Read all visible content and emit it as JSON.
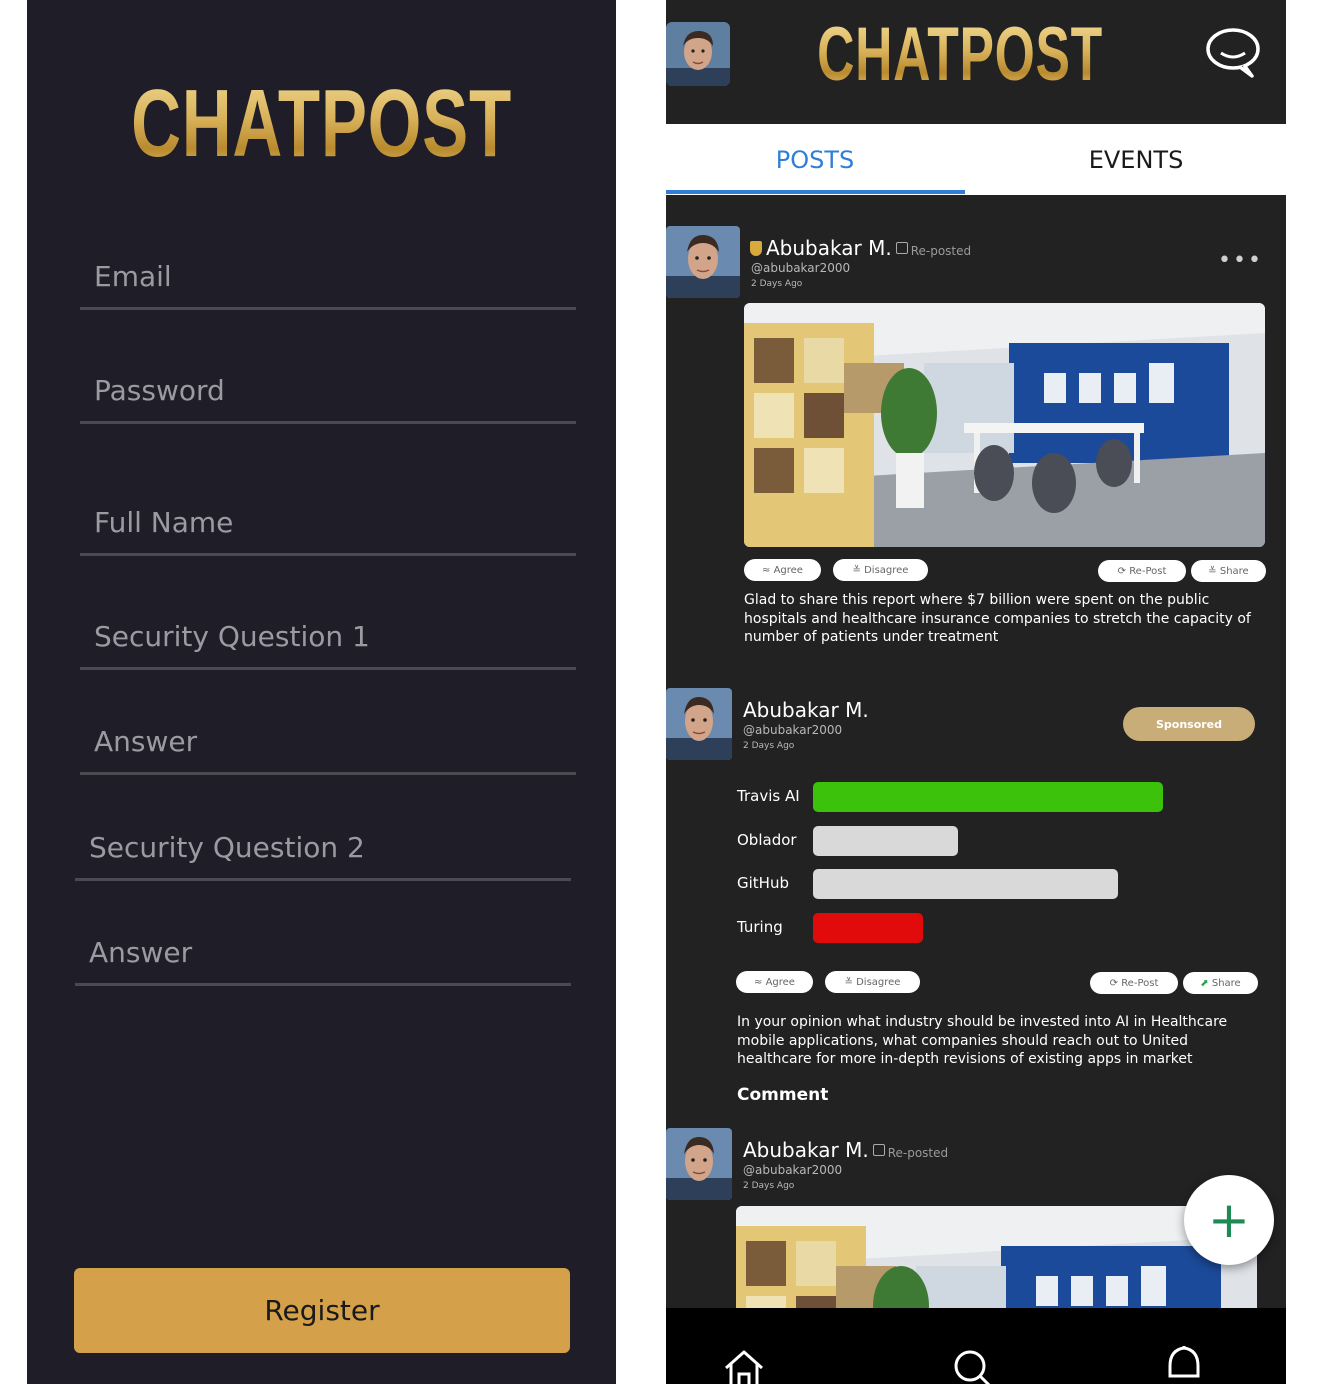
{
  "register": {
    "logo_text": "CHATPOST",
    "fields": [
      {
        "placeholder": "Email"
      },
      {
        "placeholder": "Password"
      },
      {
        "placeholder": "Full Name"
      },
      {
        "placeholder": "Security Question 1"
      },
      {
        "placeholder": "Answer"
      },
      {
        "placeholder": "Security Question 2"
      },
      {
        "placeholder": "Answer"
      }
    ],
    "register_button": "Register"
  },
  "feed": {
    "logo_text": "CHATPOST",
    "tabs": [
      {
        "label": "POSTS",
        "active": true
      },
      {
        "label": "EVENTS",
        "active": false
      }
    ],
    "posts": [
      {
        "author": "Abubakar M.",
        "badge": "Re-posted",
        "handle": "@abubakar2000",
        "time": "2 Days Ago",
        "actions": {
          "agree": "Agree",
          "disagree": "Disagree",
          "repost": "Re-Post",
          "share": "Share"
        },
        "text": "Glad to share this report where $7 billion were spent on the public hospitals and healthcare insurance companies to stretch the capacity of number of patients under treatment"
      },
      {
        "author": "Abubakar M.",
        "handle": "@abubakar2000",
        "time": "2 Days Ago",
        "sponsored_label": "Sponsored",
        "poll": [
          {
            "label": "Travis AI",
            "value": 0.7,
            "color": "#3cc20a"
          },
          {
            "label": "Oblador",
            "value": 0.29,
            "color": "#d9d9d9"
          },
          {
            "label": "GitHub",
            "value": 0.61,
            "color": "#d9d9d9"
          },
          {
            "label": "Turing",
            "value": 0.22,
            "color": "#e20b0b"
          }
        ],
        "actions": {
          "agree": "Agree",
          "disagree": "Disagree",
          "repost": "Re-Post",
          "share": "Share"
        },
        "text": "In your opinion what industry should be invested into AI in Healthcare mobile applications, what companies should reach out to United healthcare for more in-depth revisions of existing apps in market",
        "comment_label": "Comment"
      },
      {
        "author": "Abubakar M.",
        "badge": "Re-posted",
        "handle": "@abubakar2000",
        "time": "2 Days Ago"
      }
    ],
    "fab_label": "+",
    "colors": {
      "accent": "#2f7fd8",
      "gold": "#d4a14a",
      "sponsored": "#c9ad79",
      "fab_plus": "#1d8a55"
    }
  }
}
